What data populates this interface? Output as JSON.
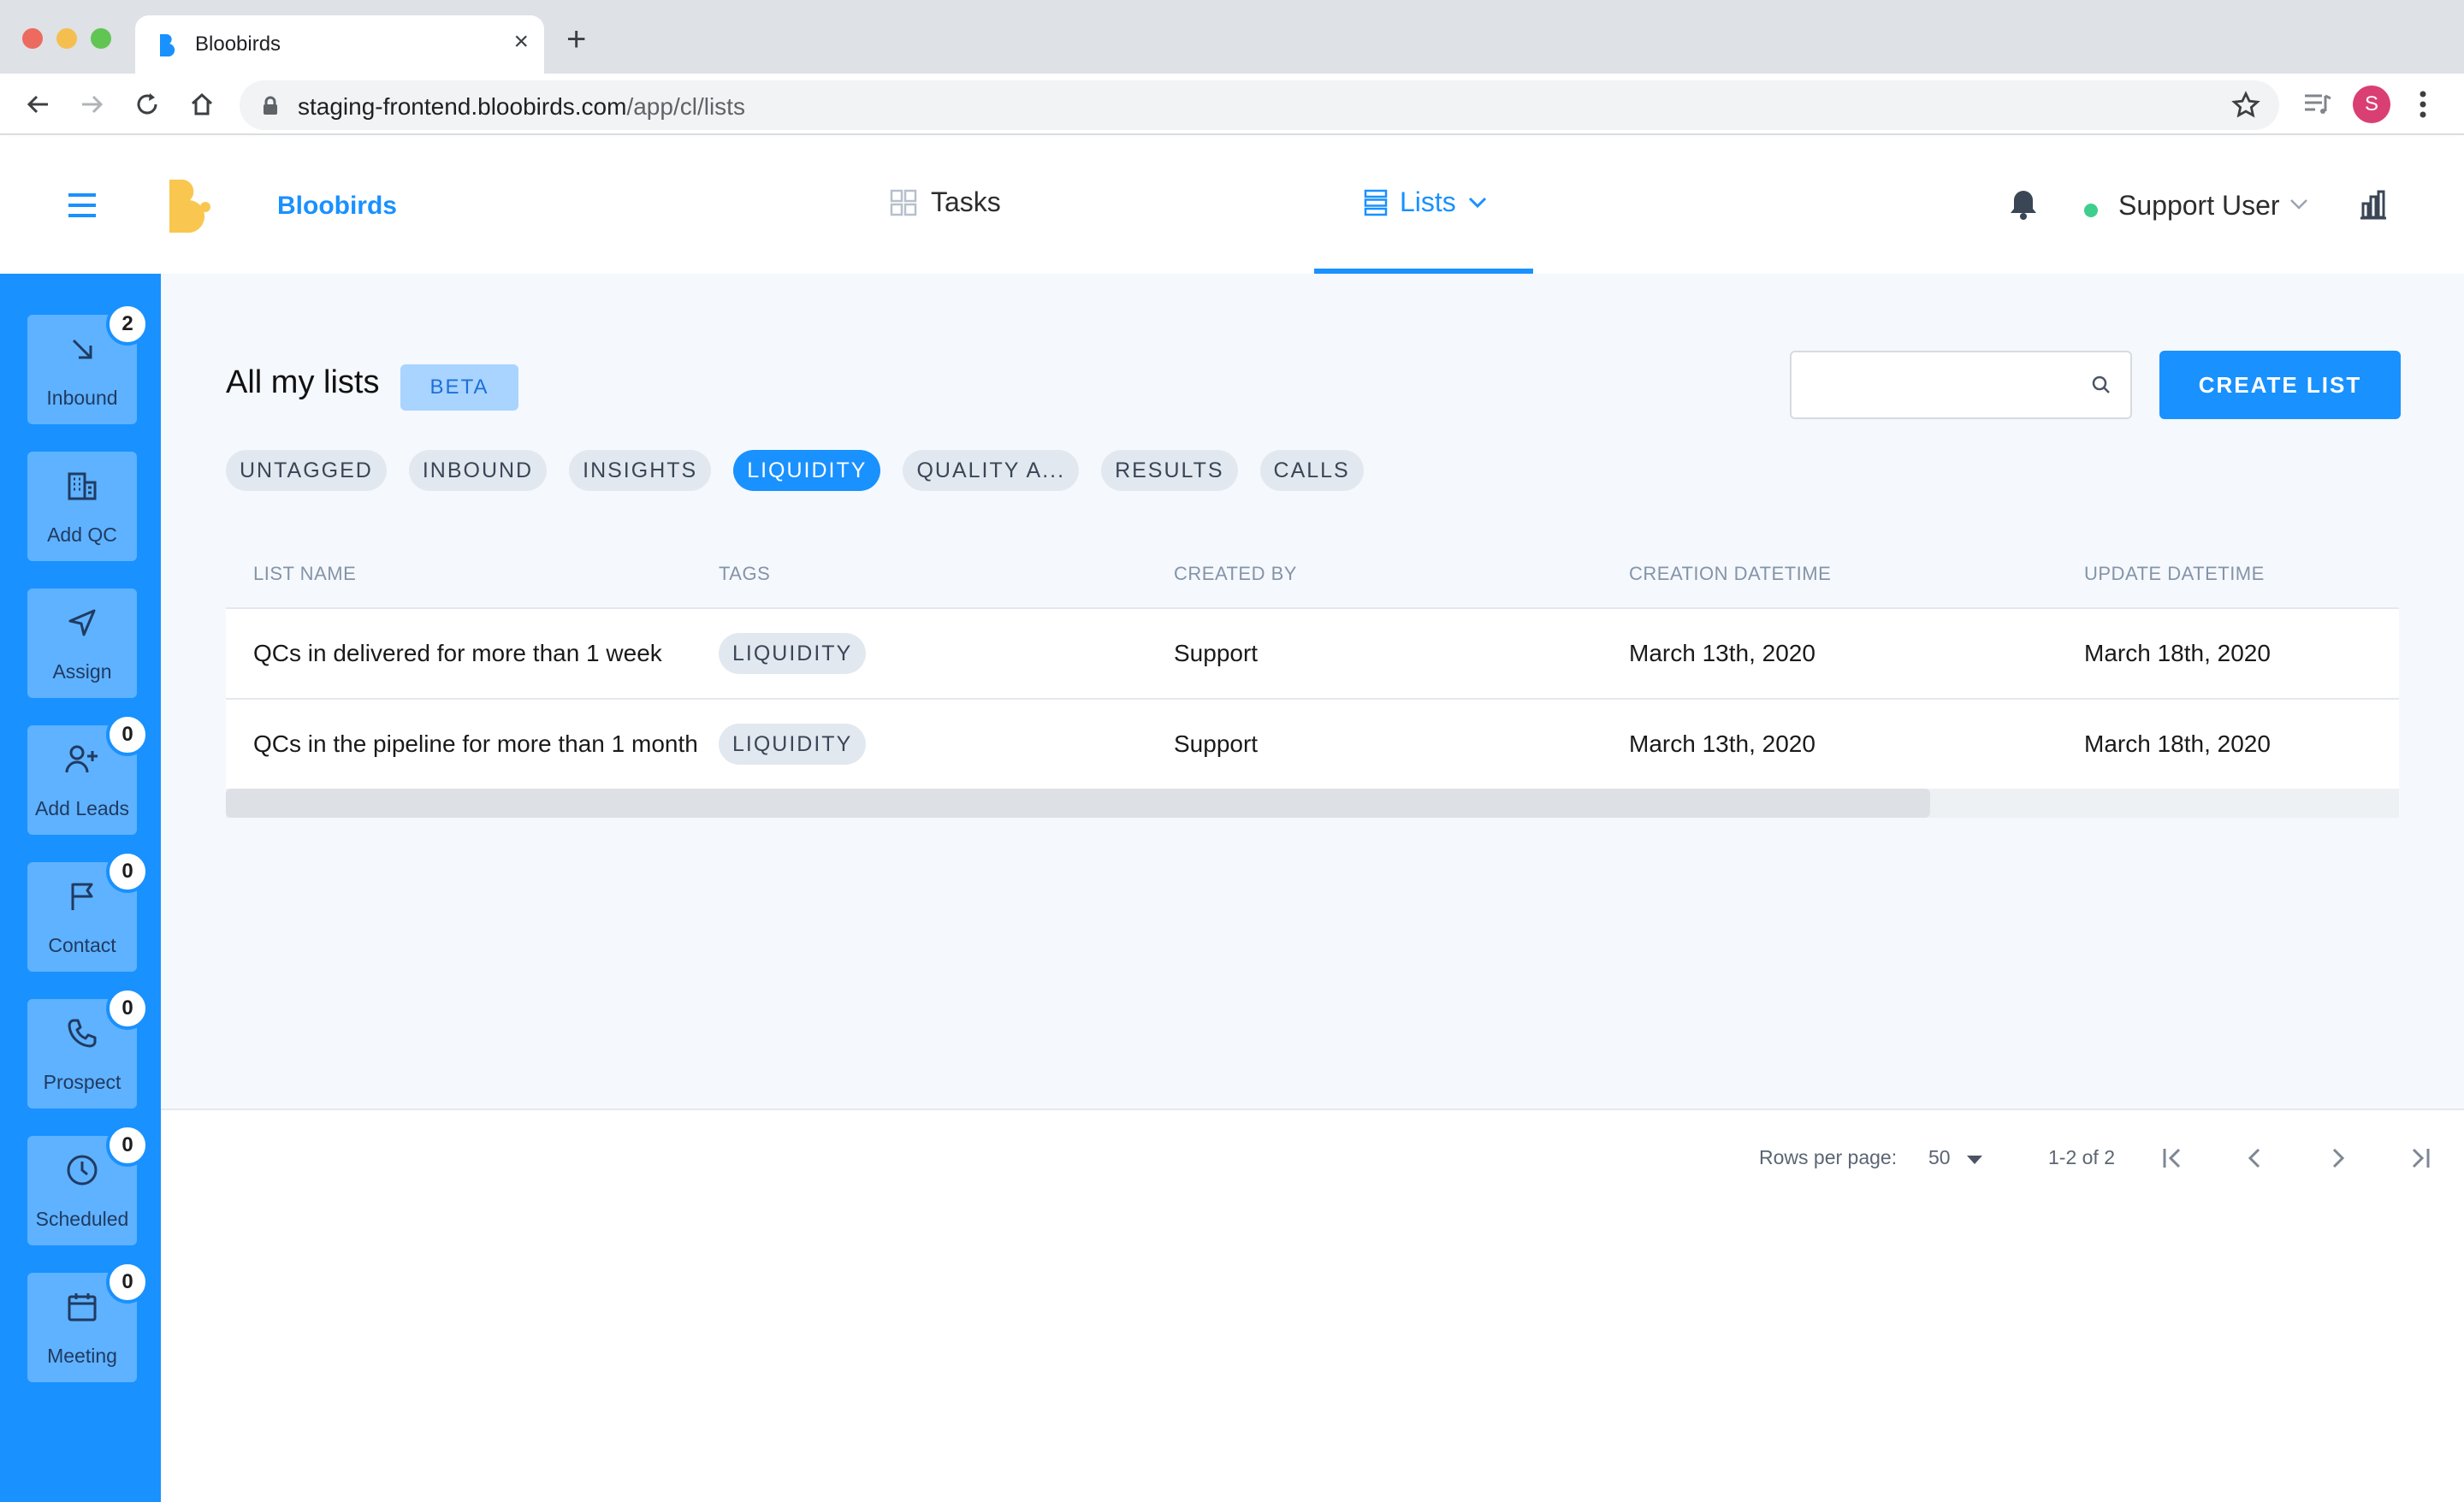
{
  "browser": {
    "tab_title": "Bloobirds",
    "new_tab_symbol": "+",
    "close_symbol": "×",
    "url_host": "staging-frontend.bloobirds.com",
    "url_path": "/app/cl/lists",
    "profile_initial": "S"
  },
  "header": {
    "brand": "Bloobirds",
    "nav_tasks": "Tasks",
    "nav_lists": "Lists",
    "user_name": "Support User",
    "colors": {
      "accent": "#1991ff",
      "logo": "#f9c74f",
      "status": "#3ecf8e"
    }
  },
  "sidebar": {
    "items": [
      {
        "label": "Inbound",
        "badge": "2",
        "icon": "arrow-down-right-icon"
      },
      {
        "label": "Add QC",
        "badge": "",
        "icon": "building-icon"
      },
      {
        "label": "Assign",
        "badge": "",
        "icon": "send-icon"
      },
      {
        "label": "Add Leads",
        "badge": "0",
        "icon": "user-plus-icon"
      },
      {
        "label": "Contact",
        "badge": "0",
        "icon": "flag-icon"
      },
      {
        "label": "Prospect",
        "badge": "0",
        "icon": "phone-icon"
      },
      {
        "label": "Scheduled",
        "badge": "0",
        "icon": "clock-icon"
      },
      {
        "label": "Meeting",
        "badge": "0",
        "icon": "calendar-icon"
      }
    ]
  },
  "main": {
    "title": "All my lists",
    "beta": "BETA",
    "search_placeholder": "",
    "create_button": "CREATE LIST",
    "filters": [
      {
        "label": "UNTAGGED",
        "active": false
      },
      {
        "label": "INBOUND",
        "active": false
      },
      {
        "label": "INSIGHTS",
        "active": false
      },
      {
        "label": "LIQUIDITY",
        "active": true
      },
      {
        "label": "QUALITY A...",
        "active": false
      },
      {
        "label": "RESULTS",
        "active": false
      },
      {
        "label": "CALLS",
        "active": false
      }
    ],
    "table": {
      "headers": [
        "LIST NAME",
        "TAGS",
        "CREATED BY",
        "CREATION DATETIME",
        "UPDATE DATETIME"
      ],
      "rows": [
        {
          "name": "QCs in delivered for more than 1 week",
          "tag": "LIQUIDITY",
          "created_by": "Support",
          "created": "March 13th, 2020",
          "updated": "March 18th, 2020"
        },
        {
          "name": "QCs in the pipeline for more than 1 month",
          "tag": "LIQUIDITY",
          "created_by": "Support",
          "created": "March 13th, 2020",
          "updated": "March 18th, 2020"
        }
      ]
    }
  },
  "pagination": {
    "rows_per_page_label": "Rows per page:",
    "rows_per_page": "50",
    "range": "1-2 of 2"
  }
}
